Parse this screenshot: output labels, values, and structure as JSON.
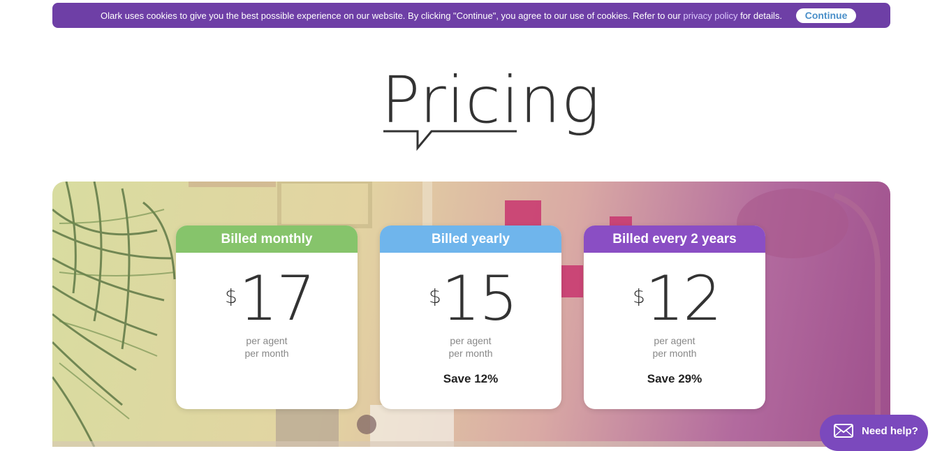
{
  "cookie_bar": {
    "text_before": "Olark uses cookies to give you the best possible experience on our website. By clicking \"Continue\", you agree to our use of cookies. Refer to our ",
    "link": "privacy policy",
    "text_after": " for details.",
    "button": "Continue"
  },
  "page_title": "Pricing",
  "plans": [
    {
      "header": "Billed monthly",
      "header_color": "#86c46b",
      "currency": "$",
      "amount": "17",
      "per_agent": "per agent",
      "per_month": "per month",
      "save": ""
    },
    {
      "header": "Billed yearly",
      "header_color": "#6fb5ec",
      "currency": "$",
      "amount": "15",
      "per_agent": "per agent",
      "per_month": "per month",
      "save": "Save 12%"
    },
    {
      "header": "Billed every 2 years",
      "header_color": "#8a4ec4",
      "currency": "$",
      "amount": "12",
      "per_agent": "per agent",
      "per_month": "per month",
      "save": "Save 29%"
    }
  ],
  "help_widget": {
    "label": "Need help?",
    "icon": "envelope-icon"
  },
  "colors": {
    "brand_purple": "#6e3fa6",
    "link": "#dcc8ff",
    "button_text": "#4a8fc9"
  }
}
